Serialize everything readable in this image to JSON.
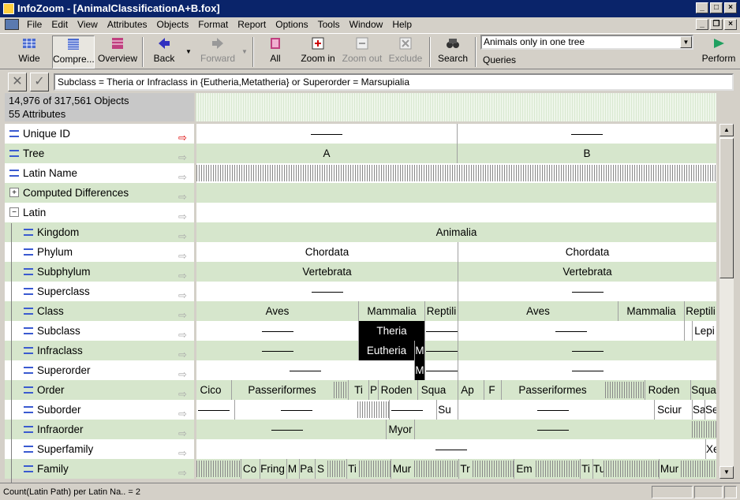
{
  "window": {
    "title": "InfoZoom - [AnimalClassificationA+B.fox]"
  },
  "menu": [
    "File",
    "Edit",
    "View",
    "Attributes",
    "Objects",
    "Format",
    "Report",
    "Options",
    "Tools",
    "Window",
    "Help"
  ],
  "toolbar": {
    "wide": "Wide",
    "compressed": "Compre...",
    "overview": "Overview",
    "back": "Back",
    "forward": "Forward",
    "all": "All",
    "zoom_in": "Zoom in",
    "zoom_out": "Zoom out",
    "exclude": "Exclude",
    "search": "Search",
    "query_value": "Animals only in one tree",
    "queries": "Queries",
    "perform": "Perform"
  },
  "filter": {
    "text": "Subclass = Theria or Infraclass in {Eutheria,Metatheria} or Superorder = Marsupialia"
  },
  "info": {
    "objects": "14,976 of 317,561 Objects",
    "attributes": "55 Attributes"
  },
  "attributes": [
    {
      "label": "Unique ID",
      "indent": 0,
      "icon": "sort"
    },
    {
      "label": "Tree",
      "indent": 0,
      "icon": "sort"
    },
    {
      "label": "Latin Name",
      "indent": 0,
      "icon": "sort"
    },
    {
      "label": "Computed Differences",
      "indent": 0,
      "icon": "plus"
    },
    {
      "label": "Latin",
      "indent": 0,
      "icon": "minus"
    },
    {
      "label": "Kingdom",
      "indent": 1,
      "icon": "sort"
    },
    {
      "label": "Phylum",
      "indent": 1,
      "icon": "sort"
    },
    {
      "label": "Subphylum",
      "indent": 1,
      "icon": "sort"
    },
    {
      "label": "Superclass",
      "indent": 1,
      "icon": "sort"
    },
    {
      "label": "Class",
      "indent": 1,
      "icon": "sort"
    },
    {
      "label": "Subclass",
      "indent": 1,
      "icon": "sort"
    },
    {
      "label": "Infraclass",
      "indent": 1,
      "icon": "sort"
    },
    {
      "label": "Superorder",
      "indent": 1,
      "icon": "sort"
    },
    {
      "label": "Order",
      "indent": 1,
      "icon": "sort"
    },
    {
      "label": "Suborder",
      "indent": 1,
      "icon": "sort"
    },
    {
      "label": "Infraorder",
      "indent": 1,
      "icon": "sort"
    },
    {
      "label": "Superfamily",
      "indent": 1,
      "icon": "sort"
    },
    {
      "label": "Family",
      "indent": 1,
      "icon": "sort"
    }
  ],
  "grid": {
    "tree": [
      "A",
      "B"
    ],
    "kingdom": "Animalia",
    "phylum": [
      "Chordata",
      "Chordata"
    ],
    "subphylum": [
      "Vertebrata",
      "Vertebrata"
    ],
    "class": [
      "Aves",
      "Mammalia",
      "Reptili",
      "Aves",
      "Mammalia",
      "Reptili"
    ],
    "subclass": [
      "Theria",
      "Lepi"
    ],
    "infraclass": [
      "Eutheria",
      "M"
    ],
    "superorder": [
      "M"
    ],
    "order": [
      "Cico",
      "Passeriformes",
      "Ti",
      "P",
      "Roden",
      "Squa",
      "Ap",
      "F",
      "Passeriformes",
      "Roden",
      "Squa"
    ],
    "suborder": [
      "Su",
      "Sciur",
      "Sa",
      "Se"
    ],
    "infraorder": [
      "Myor"
    ],
    "superfamily": [
      "Xe"
    ],
    "family": [
      "Co",
      "Fring",
      "M",
      "Pa",
      "S",
      "Ti",
      "Mur",
      "Tr",
      "Em",
      "Ti",
      "Tu",
      "Mur"
    ]
  },
  "status": {
    "text": "Count(Latin Path) per Latin Na.. = 2"
  }
}
